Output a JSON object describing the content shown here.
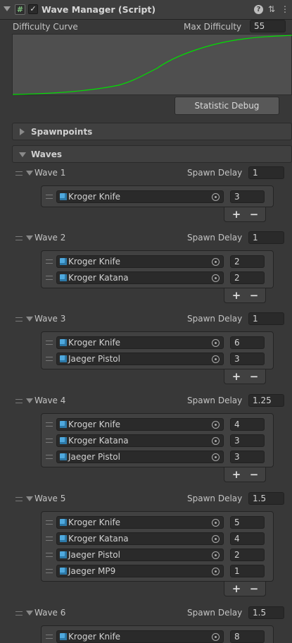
{
  "component": {
    "title": "Wave Manager (Script)",
    "enabled": true,
    "icons": [
      "script-icon",
      "help-icon",
      "presets-icon",
      "menu-icon"
    ]
  },
  "difficulty": {
    "curve_label": "Difficulty Curve",
    "max_label": "Max Difficulty",
    "max_value": "55",
    "curve_color": "#00e000"
  },
  "statistic_button": "Statistic Debug",
  "sections": {
    "spawnpoints": "Spawnpoints",
    "waves": "Waves"
  },
  "spawn_delay_label": "Spawn Delay",
  "waves": [
    {
      "name": "Wave 1",
      "delay": "1",
      "enemies": [
        {
          "name": "Kroger Knife",
          "count": "3"
        }
      ]
    },
    {
      "name": "Wave 2",
      "delay": "1",
      "enemies": [
        {
          "name": "Kroger Knife",
          "count": "2"
        },
        {
          "name": "Kroger Katana",
          "count": "2"
        }
      ]
    },
    {
      "name": "Wave 3",
      "delay": "1",
      "enemies": [
        {
          "name": "Kroger Knife",
          "count": "6"
        },
        {
          "name": "Jaeger Pistol",
          "count": "3"
        }
      ]
    },
    {
      "name": "Wave 4",
      "delay": "1.25",
      "enemies": [
        {
          "name": "Kroger Knife",
          "count": "4"
        },
        {
          "name": "Kroger Katana",
          "count": "3"
        },
        {
          "name": "Jaeger Pistol",
          "count": "3"
        }
      ]
    },
    {
      "name": "Wave 5",
      "delay": "1.5",
      "enemies": [
        {
          "name": "Kroger Knife",
          "count": "5"
        },
        {
          "name": "Kroger Katana",
          "count": "4"
        },
        {
          "name": "Jaeger Pistol",
          "count": "2"
        },
        {
          "name": "Jaeger MP9",
          "count": "1"
        }
      ]
    },
    {
      "name": "Wave 6",
      "delay": "1.5",
      "enemies": [
        {
          "name": "Kroger Knife",
          "count": "8"
        }
      ]
    }
  ],
  "list_buttons": {
    "plus": "+",
    "minus": "−"
  }
}
